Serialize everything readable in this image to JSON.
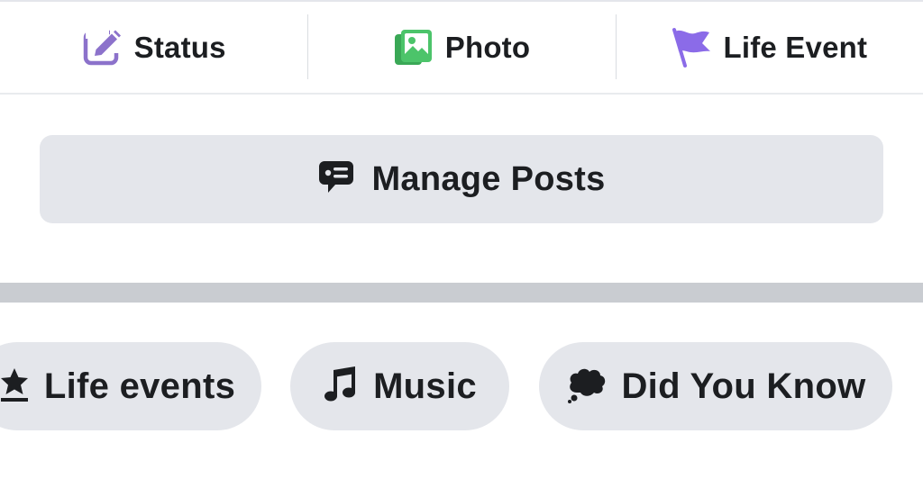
{
  "composer": {
    "status": {
      "label": "Status",
      "icon": "edit-square-icon",
      "color": "#8c72cb"
    },
    "photo": {
      "label": "Photo",
      "icon": "photo-icon",
      "color": "#45bd62"
    },
    "life_event": {
      "label": "Life Event",
      "icon": "flag-icon",
      "color": "#8b6be8"
    }
  },
  "manage_posts": {
    "label": "Manage Posts",
    "icon": "speech-bubble-icon"
  },
  "chips": [
    {
      "label": "Life events",
      "icon": "star-upload-icon"
    },
    {
      "label": "Music",
      "icon": "music-note-icon"
    },
    {
      "label": "Did You Know",
      "icon": "thought-bubble-icon"
    }
  ]
}
